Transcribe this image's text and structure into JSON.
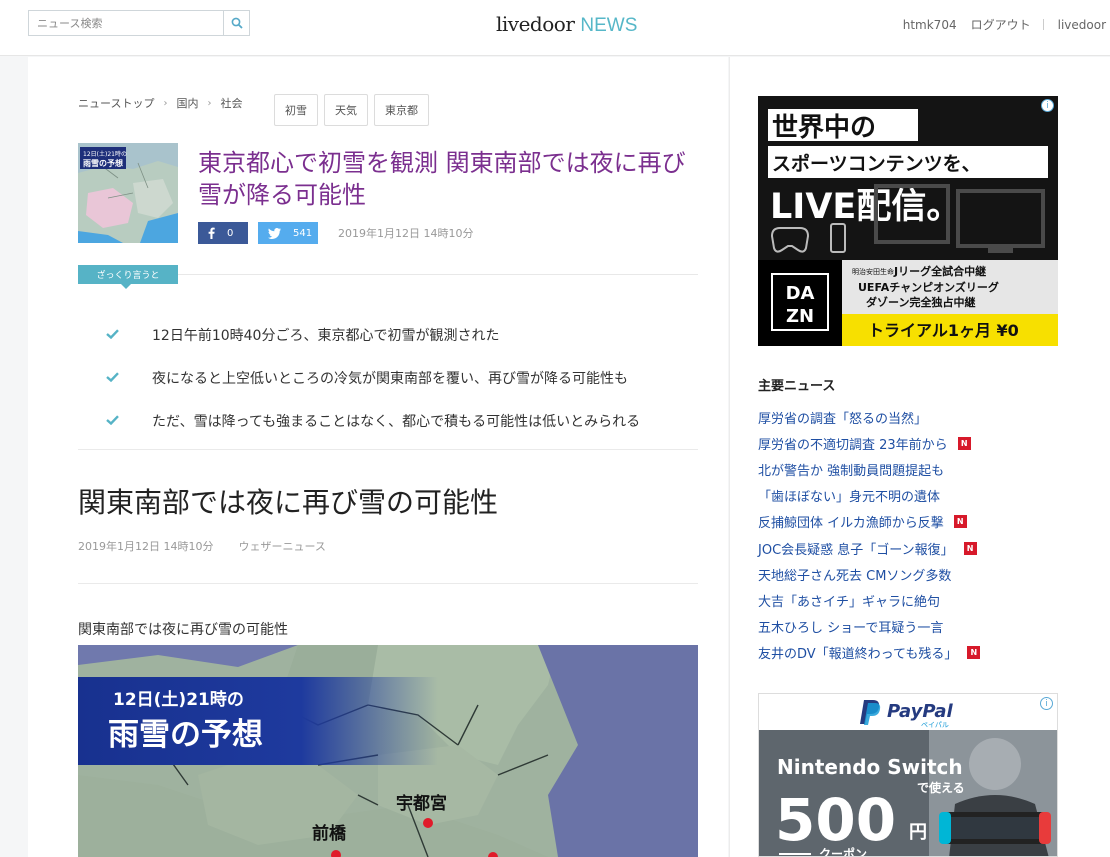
{
  "header": {
    "search_placeholder": "ニュース検索",
    "logo_main": "livedoor",
    "logo_news": "NEWS",
    "username": "htmk704",
    "logout": "ログアウト",
    "brand_link": "livedoor"
  },
  "breadcrumb": {
    "items": [
      "ニューストップ",
      "国内",
      "社会"
    ],
    "separator": "›"
  },
  "tags": [
    "初雪",
    "天気",
    "東京都"
  ],
  "article": {
    "title": "東京都心で初雪を観測 関東南部では夜に再び雪が降る可能性",
    "thumb_label_line1": "12日(土)21時の",
    "thumb_label_line2": "雨雪の予想",
    "fb_count": "0",
    "tw_count": "541",
    "date": "2019年1月12日 14時10分",
    "summary_badge": "ざっくり言うと",
    "summary": [
      "12日午前10時40分ごろ、東京都心で初雪が観測された",
      "夜になると上空低いところの冷気が関東南部を覆い、再び雪が降る可能性も",
      "ただ、雪は降っても強まることはなく、都心で積もる可能性は低いとみられる"
    ],
    "heading": "関東南部では夜に再び雪の可能性",
    "meta_date": "2019年1月12日 14時10分",
    "meta_source": "ウェザーニュース",
    "image_caption": "関東南部では夜に再び雪の可能性",
    "figure": {
      "line1": "12日(土)21時の",
      "line2": "雨雪の予想",
      "city1": "宇都宮",
      "city2": "前橋"
    }
  },
  "sidebar": {
    "ad1": {
      "line1": "世界中の",
      "line2": "スポーツコンテンツを、",
      "line3": "LIVE配信。",
      "brand_top": "DA",
      "brand_bottom": "ZN",
      "sponsor": "明治安田生命",
      "info1": "Jリーグ全試合中継",
      "info2": "UEFAチャンピオンズリーグ",
      "info3": "ダゾーン完全独占中継",
      "cta": "トライアル1ヶ月 ¥0"
    },
    "top_news_title": "主要ニュース",
    "top_news": [
      {
        "text": "厚労省の調査「怒るの当然」",
        "new": false
      },
      {
        "text": "厚労省の不適切調査 23年前から",
        "new": true
      },
      {
        "text": "北が警告か 強制動員問題提起も",
        "new": false
      },
      {
        "text": "「歯ほぼない」身元不明の遺体",
        "new": false
      },
      {
        "text": "反捕鯨団体 イルカ漁師から反撃",
        "new": true
      },
      {
        "text": "JOC会長疑惑 息子「ゴーン報復」",
        "new": true
      },
      {
        "text": "天地総子さん死去 CMソング多数",
        "new": false
      },
      {
        "text": "大吉「あさイチ」ギャラに絶句",
        "new": false
      },
      {
        "text": "五木ひろし ショーで耳疑う一言",
        "new": false
      },
      {
        "text": "友井のDV「報道終わっても残る」",
        "new": true
      }
    ],
    "new_badge": "N",
    "ad2": {
      "brand": "PayPal",
      "brand_sub": "ペイパル",
      "line1": "Nintendo Switch",
      "line2": "で使える",
      "amount": "500",
      "unit": "円",
      "coupon": "クーポン"
    },
    "ad_info": "i"
  },
  "colors": {
    "accent": "#56b3c6",
    "title_purple": "#7b2f8f",
    "link_blue": "#1f4fa3",
    "new_red": "#d7192a",
    "facebook": "#3b5998",
    "twitter": "#55acee",
    "dazn_yellow": "#f7e000"
  }
}
